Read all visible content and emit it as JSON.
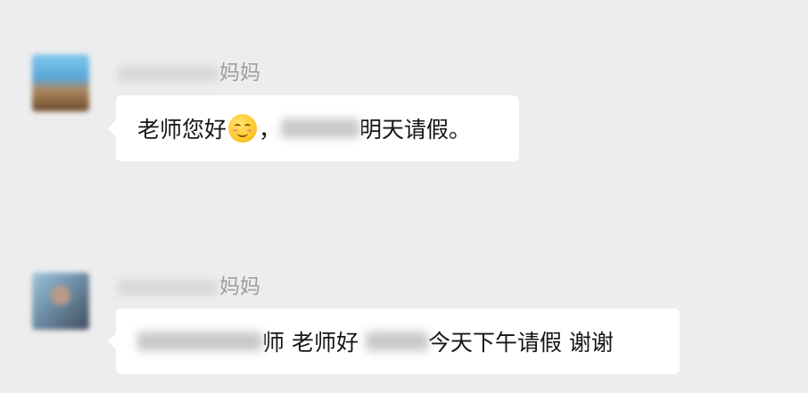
{
  "messages": [
    {
      "sender_suffix": "妈妈",
      "parts": {
        "a": "老师您好",
        "emoji": "smiling-face-emoji",
        "b": "，",
        "c": "明天请假。"
      }
    },
    {
      "sender_suffix": "妈妈",
      "parts": {
        "a": "师 老师好",
        "b": "今天下午请假 谢谢"
      }
    }
  ]
}
